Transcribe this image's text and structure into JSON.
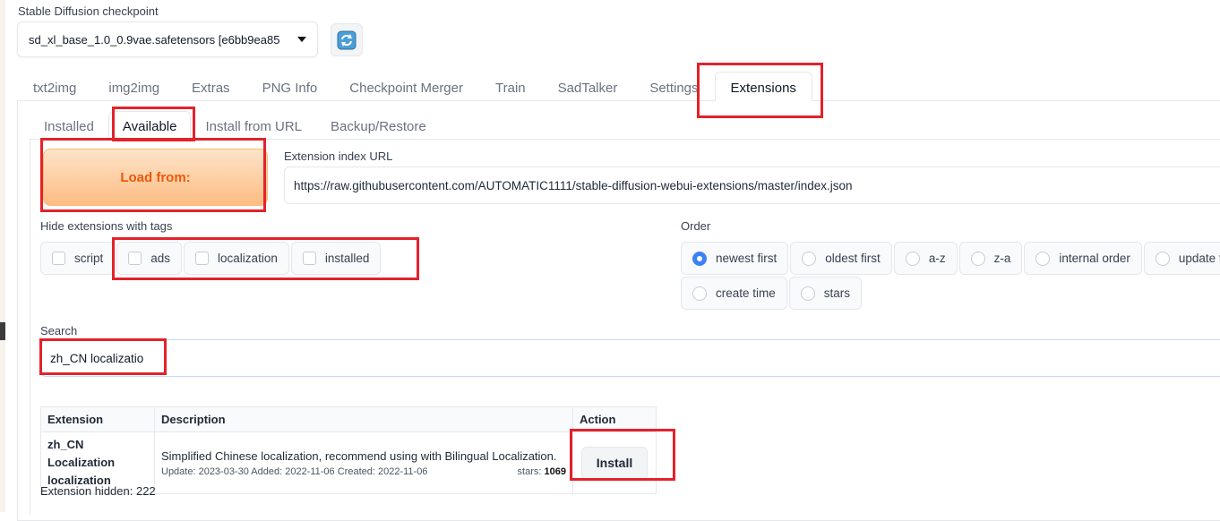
{
  "checkpoint": {
    "label": "Stable Diffusion checkpoint",
    "value": "sd_xl_base_1.0_0.9vae.safetensors [e6bb9ea85"
  },
  "main_tabs": [
    {
      "label": "txt2img"
    },
    {
      "label": "img2img"
    },
    {
      "label": "Extras"
    },
    {
      "label": "PNG Info"
    },
    {
      "label": "Checkpoint Merger"
    },
    {
      "label": "Train"
    },
    {
      "label": "SadTalker"
    },
    {
      "label": "Settings"
    },
    {
      "label": "Extensions",
      "active": true
    }
  ],
  "sub_tabs": [
    {
      "label": "Installed"
    },
    {
      "label": "Available",
      "active": true
    },
    {
      "label": "Install from URL"
    },
    {
      "label": "Backup/Restore"
    }
  ],
  "load_button": "Load from:",
  "index_url": {
    "label": "Extension index URL",
    "value": "https://raw.githubusercontent.com/AUTOMATIC1111/stable-diffusion-webui-extensions/master/index.json"
  },
  "hide_tags": {
    "label": "Hide extensions with tags",
    "options": [
      "script",
      "ads",
      "localization",
      "installed"
    ]
  },
  "order": {
    "label": "Order",
    "options": [
      "newest first",
      "oldest first",
      "a-z",
      "z-a",
      "internal order",
      "update time",
      "create time",
      "stars"
    ],
    "selected": "newest first"
  },
  "search": {
    "label": "Search",
    "value": "zh_CN localizatio"
  },
  "table": {
    "headers": [
      "Extension",
      "Description",
      "Action"
    ],
    "rows": [
      {
        "name": "zh_CN Localization",
        "tag": "localization",
        "description": "Simplified Chinese localization, recommend using with Bilingual Localization.",
        "dates": "Update: 2023-03-30 Added: 2022-11-06 Created: 2022-11-06",
        "stars_label": "stars:",
        "stars": "1069",
        "action": "Install"
      }
    ]
  },
  "hidden_count": "Extension hidden: 222",
  "colors": {
    "accent_orange": "#ea580c",
    "annotation_red": "#e3222b",
    "radio_blue": "#3b82f6"
  }
}
